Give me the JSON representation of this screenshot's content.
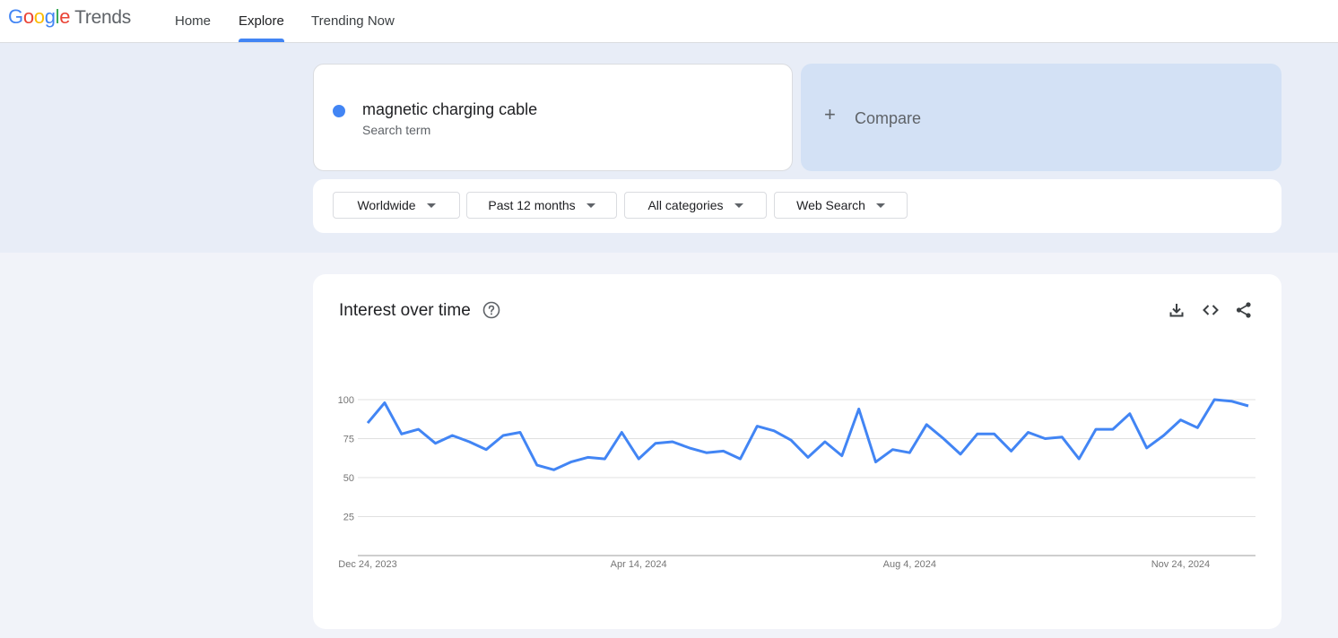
{
  "header": {
    "logo": {
      "google": [
        "G",
        "o",
        "o",
        "g",
        "l",
        "e"
      ],
      "product": "Trends"
    },
    "nav": [
      {
        "label": "Home",
        "active": false
      },
      {
        "label": "Explore",
        "active": true
      },
      {
        "label": "Trending Now",
        "active": false
      }
    ]
  },
  "search": {
    "term": "magnetic charging cable",
    "term_type": "Search term",
    "term_color": "#4285f4",
    "compare_label": "Compare",
    "compare_icon": "plus-icon"
  },
  "filters": [
    {
      "label": "Worldwide"
    },
    {
      "label": "Past 12 months"
    },
    {
      "label": "All categories"
    },
    {
      "label": "Web Search"
    }
  ],
  "chart": {
    "title": "Interest over time",
    "actions": [
      "download-icon",
      "embed-code-icon",
      "share-icon"
    ]
  },
  "chart_data": {
    "type": "line",
    "series": [
      {
        "name": "magnetic charging cable",
        "color": "#4285f4",
        "values": [
          85,
          98,
          78,
          81,
          72,
          77,
          73,
          68,
          77,
          79,
          58,
          55,
          60,
          63,
          62,
          79,
          62,
          72,
          73,
          69,
          66,
          67,
          62,
          83,
          80,
          74,
          63,
          73,
          64,
          94,
          60,
          68,
          66,
          84,
          75,
          65,
          78,
          78,
          67,
          79,
          75,
          76,
          62,
          81,
          81,
          91,
          69,
          77,
          87,
          82,
          100,
          99,
          96
        ]
      }
    ],
    "x_tick_labels": [
      "Dec 24, 2023",
      "Apr 14, 2024",
      "Aug 4, 2024",
      "Nov 24, 2024"
    ],
    "x_tick_indices": [
      0,
      16,
      32,
      48
    ],
    "y_ticks": [
      100,
      75,
      50,
      25
    ],
    "ylim": [
      0,
      100
    ],
    "grid": true
  }
}
